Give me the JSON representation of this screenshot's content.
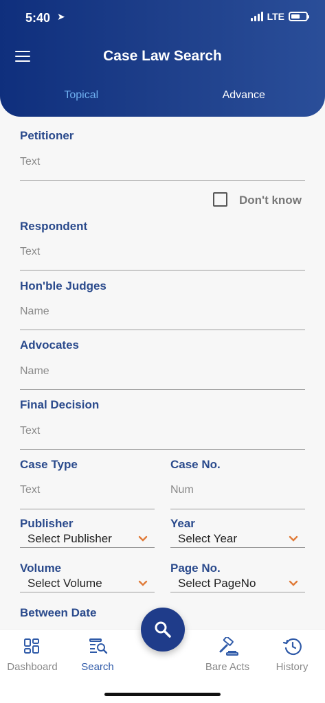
{
  "status": {
    "time": "5:40",
    "network": "LTE"
  },
  "header": {
    "title": "Case Law Search",
    "tabs": [
      {
        "label": "Topical",
        "active": true
      },
      {
        "label": "Advance",
        "active": false
      }
    ]
  },
  "form": {
    "petitioner": {
      "label": "Petitioner",
      "placeholder": "Text"
    },
    "dont_know": "Don't know",
    "respondent": {
      "label": "Respondent",
      "placeholder": "Text"
    },
    "judges": {
      "label": "Hon'ble Judges",
      "placeholder": "Name"
    },
    "advocates": {
      "label": "Advocates",
      "placeholder": "Name"
    },
    "final_decision": {
      "label": "Final Decision",
      "placeholder": "Text"
    },
    "case_type": {
      "label": "Case Type",
      "placeholder": "Text"
    },
    "case_no": {
      "label": "Case No.",
      "placeholder": "Num"
    },
    "publisher": {
      "label": "Publisher",
      "value": "Select Publisher"
    },
    "year": {
      "label": "Year",
      "value": "Select Year"
    },
    "volume": {
      "label": "Volume",
      "value": "Select Volume"
    },
    "page_no": {
      "label": "Page No.",
      "value": "Select PageNo"
    },
    "between_date": {
      "label": "Between Date"
    }
  },
  "nav": {
    "items": [
      {
        "label": "Dashboard",
        "icon": "dashboard-icon"
      },
      {
        "label": "Search",
        "icon": "search-doc-icon",
        "active": true
      },
      {
        "label": "Bare Acts",
        "icon": "gavel-icon"
      },
      {
        "label": "History",
        "icon": "history-icon"
      }
    ]
  },
  "colors": {
    "header": "#1e3f8a",
    "label": "#2a4a8c",
    "tab_active": "#6fb0f0",
    "chevron": "#e07b39",
    "fab": "#1f3c8a"
  }
}
